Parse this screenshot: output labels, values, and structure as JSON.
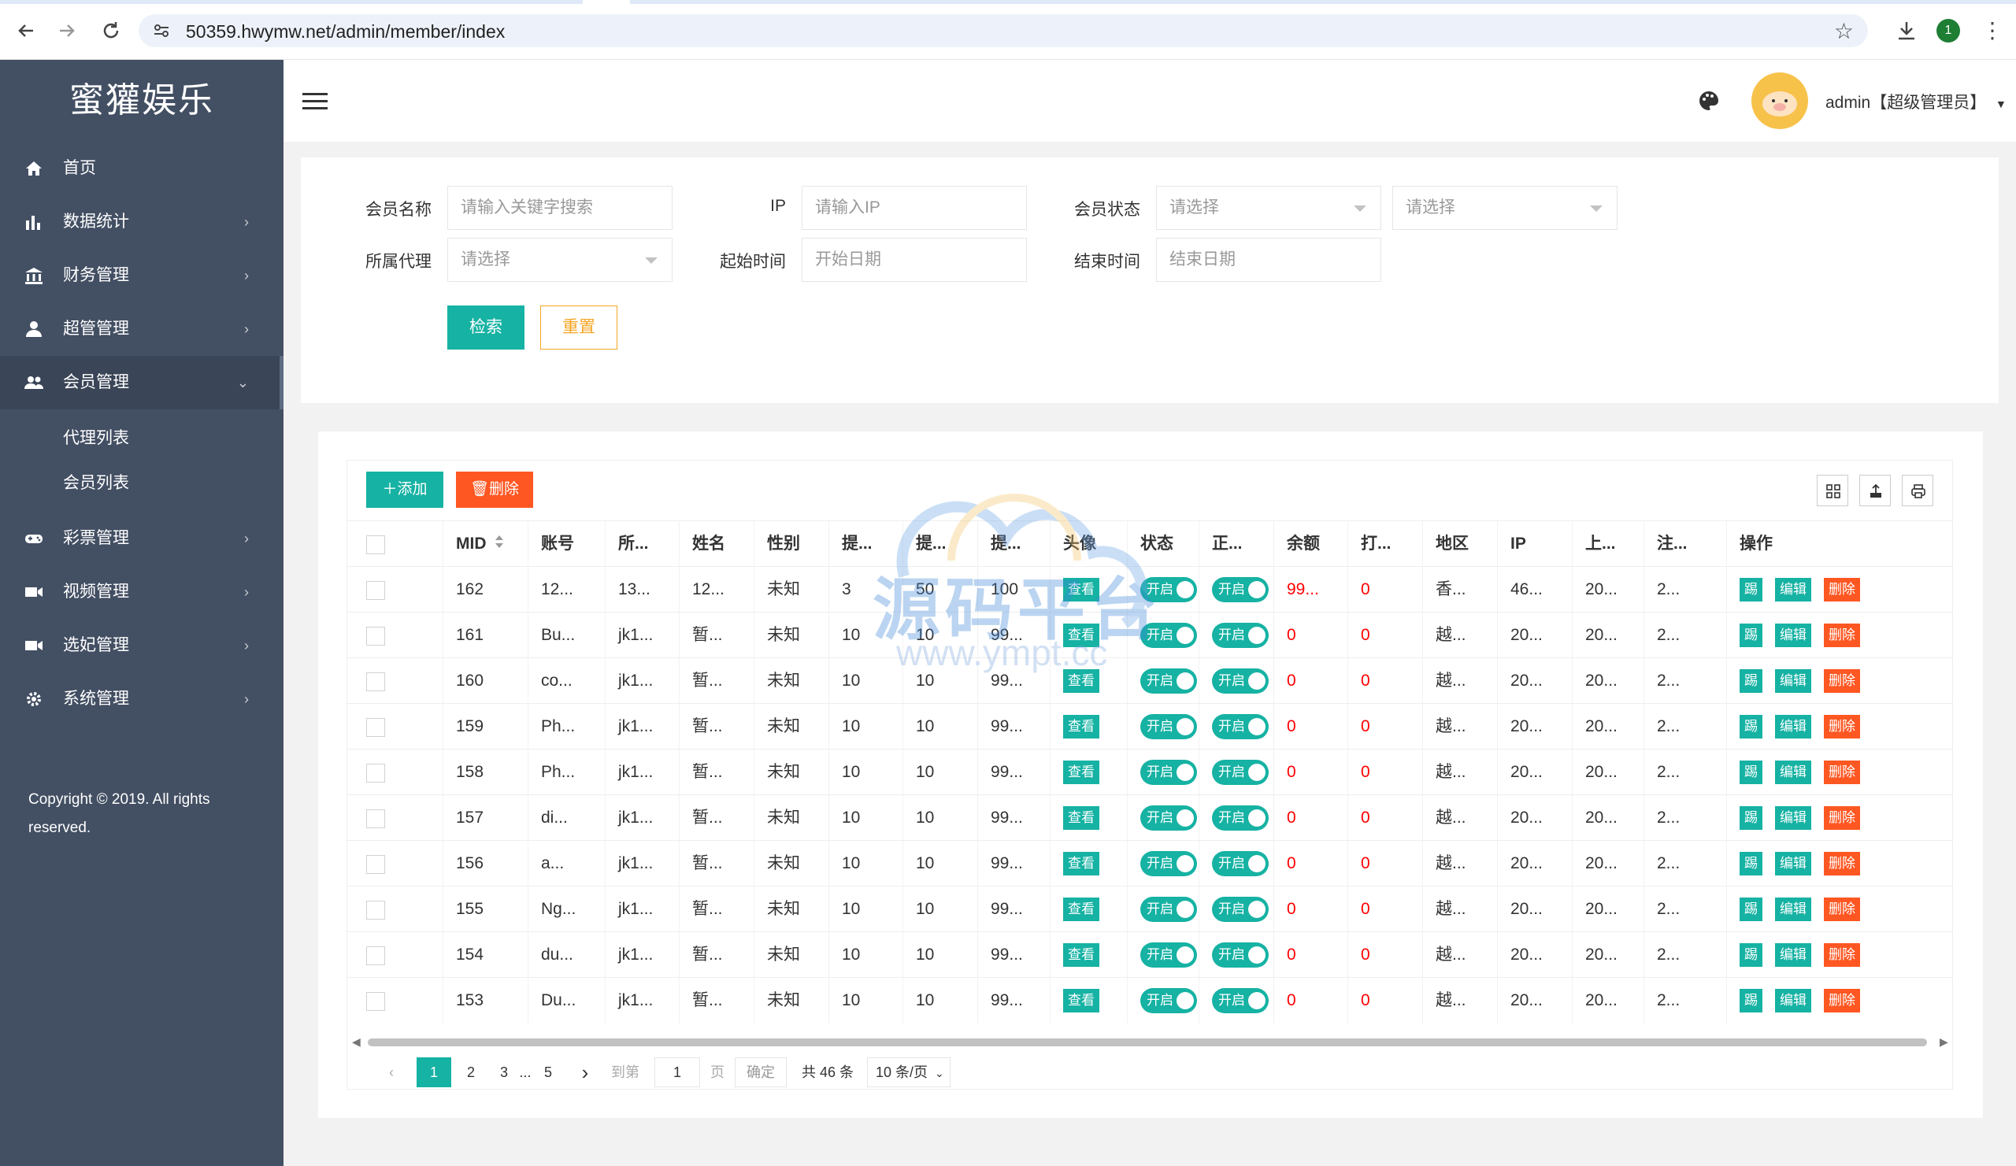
{
  "browser": {
    "url": "50359.hwymw.net/admin/member/index",
    "profile_badge": "1"
  },
  "sidebar": {
    "logo": "蜜獾娱乐",
    "items": [
      {
        "label": "首页",
        "icon": "home-icon",
        "has_arrow": false
      },
      {
        "label": "数据统计",
        "icon": "bar-chart-icon",
        "has_arrow": true
      },
      {
        "label": "财务管理",
        "icon": "bank-icon",
        "has_arrow": true
      },
      {
        "label": "超管管理",
        "icon": "user-icon",
        "has_arrow": true
      },
      {
        "label": "会员管理",
        "icon": "users-icon",
        "has_arrow": true,
        "active": true
      }
    ],
    "submenu": [
      "代理列表",
      "会员列表"
    ],
    "items_after": [
      {
        "label": "彩票管理",
        "icon": "gamepad-icon"
      },
      {
        "label": "视频管理",
        "icon": "video-icon"
      },
      {
        "label": "选妃管理",
        "icon": "video-icon"
      },
      {
        "label": "系统管理",
        "icon": "gear-icon"
      }
    ],
    "copyright": "Copyright © 2019. All rights reserved."
  },
  "header": {
    "user": "admin【超级管理员】"
  },
  "search": {
    "member_name_label": "会员名称",
    "member_name_placeholder": "请输入关键字搜索",
    "ip_label": "IP",
    "ip_placeholder": "请输入IP",
    "status_label": "会员状态",
    "status_select1": "请选择",
    "status_select2": "请选择",
    "agent_label": "所属代理",
    "agent_select": "请选择",
    "start_label": "起始时间",
    "start_placeholder": "开始日期",
    "end_label": "结束时间",
    "end_placeholder": "结束日期",
    "search_btn": "检索",
    "reset_btn": "重置"
  },
  "toolbar": {
    "add": "添加",
    "delete": "删除"
  },
  "table": {
    "columns": [
      "MID",
      "账号",
      "所...",
      "姓名",
      "性别",
      "提...",
      "提...",
      "提...",
      "头像",
      "状态",
      "正...",
      "余额",
      "打...",
      "地区",
      "IP",
      "上...",
      "注...",
      "操作"
    ],
    "view_label": "查看",
    "on_label": "开启",
    "op_labels": [
      "踢",
      "编辑",
      "删除"
    ],
    "rows": [
      [
        "162",
        "12...",
        "13...",
        "12...",
        "未知",
        "3",
        "50",
        "100",
        "99...",
        "0",
        "香...",
        "46...",
        "20...",
        "2..."
      ],
      [
        "161",
        "Bu...",
        "jk1...",
        "暂...",
        "未知",
        "10",
        "10",
        "99...",
        "0",
        "0",
        "越...",
        "20...",
        "20...",
        "2..."
      ],
      [
        "160",
        "co...",
        "jk1...",
        "暂...",
        "未知",
        "10",
        "10",
        "99...",
        "0",
        "0",
        "越...",
        "20...",
        "20...",
        "2..."
      ],
      [
        "159",
        "Ph...",
        "jk1...",
        "暂...",
        "未知",
        "10",
        "10",
        "99...",
        "0",
        "0",
        "越...",
        "20...",
        "20...",
        "2..."
      ],
      [
        "158",
        "Ph...",
        "jk1...",
        "暂...",
        "未知",
        "10",
        "10",
        "99...",
        "0",
        "0",
        "越...",
        "20...",
        "20...",
        "2..."
      ],
      [
        "157",
        "di...",
        "jk1...",
        "暂...",
        "未知",
        "10",
        "10",
        "99...",
        "0",
        "0",
        "越...",
        "20...",
        "20...",
        "2..."
      ],
      [
        "156",
        "a...",
        "jk1...",
        "暂...",
        "未知",
        "10",
        "10",
        "99...",
        "0",
        "0",
        "越...",
        "20...",
        "20...",
        "2..."
      ],
      [
        "155",
        "Ng...",
        "jk1...",
        "暂...",
        "未知",
        "10",
        "10",
        "99...",
        "0",
        "0",
        "越...",
        "20...",
        "20...",
        "2..."
      ],
      [
        "154",
        "du...",
        "jk1...",
        "暂...",
        "未知",
        "10",
        "10",
        "99...",
        "0",
        "0",
        "越...",
        "20...",
        "20...",
        "2..."
      ],
      [
        "153",
        "Du...",
        "jk1...",
        "暂...",
        "未知",
        "10",
        "10",
        "99...",
        "0",
        "0",
        "越...",
        "20...",
        "20...",
        "2..."
      ]
    ]
  },
  "pager": {
    "pages": [
      "1",
      "2",
      "3",
      "...",
      "5"
    ],
    "goto_label": "到第",
    "goto_value": "1",
    "page_suffix": "页",
    "confirm": "确定",
    "total": "共 46 条",
    "page_size": "10 条/页"
  },
  "watermark": {
    "text": "源码平台",
    "url": "www.ympt.cc"
  },
  "colors": {
    "sidebar_bg": "#434f63",
    "accent_teal": "#16b2a3",
    "danger": "#ff5722",
    "reset_border": "#f5a623"
  }
}
